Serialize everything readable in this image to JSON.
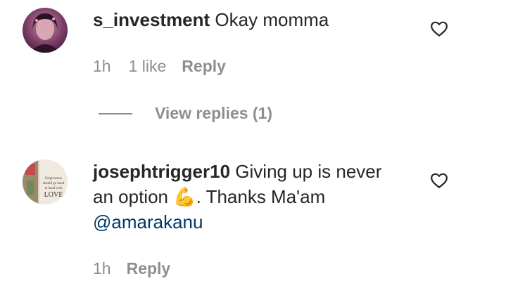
{
  "comments": [
    {
      "username": "s_investment",
      "text": "Okay momma",
      "time": "1h",
      "likes": "1 like",
      "reply_label": "Reply",
      "avatar_icon": "user-avatar-icon",
      "heart_icon": "heart-outline-icon"
    },
    {
      "username": "josephtrigger10",
      "text_line1": "Giving up is never",
      "text_line2_pre": "an option ",
      "emoji": "💪",
      "text_line2_post": ". Thanks Ma'am",
      "mention": "@amarakanu",
      "time": "1h",
      "reply_label": "Reply",
      "avatar_text": [
        "Forgiveness",
        "should go hand",
        "in hand with",
        "LOVE"
      ],
      "avatar_icon": "user-avatar-icon",
      "heart_icon": "heart-outline-icon"
    }
  ],
  "view_replies": {
    "label": "View replies (1)"
  },
  "colors": {
    "text": "#262626",
    "muted": "#8e8e8e",
    "mention": "#00376b"
  }
}
